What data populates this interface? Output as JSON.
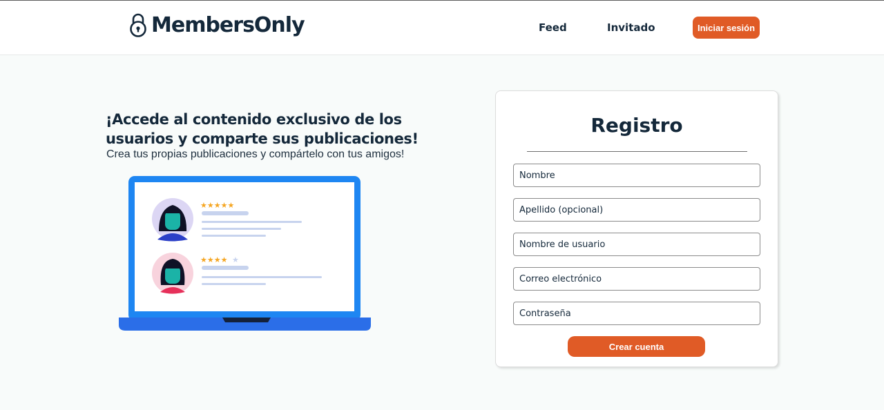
{
  "brand": {
    "name": "MembersOnly",
    "icon": "padlock-icon"
  },
  "nav": {
    "feed": "Feed",
    "guest": "Invitado",
    "login": "Iniciar sesión"
  },
  "hero": {
    "title": "¡Accede al contenido exclusivo de los usuarios y comparte sus publicaciones!",
    "subtitle": "Crea tus propias publicaciones y compártelo con tus amigos!",
    "illustration": {
      "reviews": [
        {
          "rating": 5,
          "max": 5
        },
        {
          "rating": 4,
          "max": 5
        }
      ]
    }
  },
  "register": {
    "title": "Registro",
    "fields": {
      "name": "Nombre",
      "lastname": "Apellido (opcional)",
      "username": "Nombre de usuario",
      "email": "Correo electrónico",
      "password": "Contraseña"
    },
    "submit": "Crear cuenta"
  },
  "colors": {
    "accent": "#e05b26",
    "text": "#14283a",
    "laptop": "#1e86f2",
    "background": "#f8fbfa"
  }
}
